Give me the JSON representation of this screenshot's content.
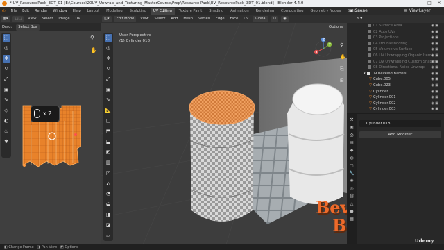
{
  "title": "* UV_ResourcePack_3DT_01 [E:\\Courses\\20UV_Unwrap_and_Texturing_MasterCourse\\Prep\\Resource Pack\\UV_ResourcePack_3DT_01.blend] - Blender 4.4.0",
  "menu": [
    "File",
    "Edit",
    "Render",
    "Window",
    "Help"
  ],
  "workspaces": [
    "Layout",
    "Modeling",
    "Sculpting",
    "UV Editing",
    "Texture Paint",
    "Shading",
    "Animation",
    "Rendering",
    "Compositing",
    "Geometry Nodes",
    "Scripting"
  ],
  "active_workspace": "UV Editing",
  "scene": "Scene",
  "view_layer": "ViewLayer",
  "uv_editor": {
    "header": [
      "View",
      "Select",
      "Image",
      "UV"
    ],
    "drag_label": "Drag:",
    "drag_value": "Select Box",
    "key_hint": "x 2"
  },
  "viewport": {
    "mode": "Edit Mode",
    "menus": [
      "View",
      "Select",
      "Add",
      "Mesh",
      "Vertex",
      "Edge",
      "Face",
      "UV"
    ],
    "orientation": "Global",
    "options": "Options",
    "perspective": "User Perspective",
    "object_info": "(1) Cylinder.018",
    "gizmo_axes": [
      "Y",
      "Z",
      "X"
    ],
    "render_text": [
      "Beve",
      "Ba"
    ]
  },
  "outliner": {
    "items": [
      {
        "label": "01 Surface Area",
        "dim": true,
        "indent": 1
      },
      {
        "label": "02 Auto UVs",
        "dim": true,
        "indent": 1
      },
      {
        "label": "03 Projections",
        "dim": true,
        "indent": 1
      },
      {
        "label": "04 Troubleshooting",
        "dim": true,
        "indent": 1
      },
      {
        "label": "05 Volume vs Surface",
        "dim": true,
        "indent": 1
      },
      {
        "label": "06 UV Unwrapping Organic Items",
        "dim": true,
        "indent": 1
      },
      {
        "label": "07 UV Unwrapping Custom Shapes",
        "dim": true,
        "indent": 1
      },
      {
        "label": "08 Directional Noise Unwrap",
        "dim": true,
        "indent": 1
      },
      {
        "label": "09 Beveled Barrels",
        "dim": false,
        "indent": 1
      },
      {
        "label": "Cube.005",
        "dim": false,
        "indent": 2
      },
      {
        "label": "Cube.023",
        "dim": false,
        "indent": 2
      },
      {
        "label": "Cylinder",
        "dim": false,
        "indent": 2
      },
      {
        "label": "Cylinder.001",
        "dim": false,
        "indent": 2
      },
      {
        "label": "Cylinder.002",
        "dim": false,
        "indent": 2
      },
      {
        "label": "Cylinder.003",
        "dim": false,
        "indent": 2
      }
    ]
  },
  "properties": {
    "object_name": "Cylinder.018",
    "add_modifier": "Add Modifier"
  },
  "statusbar": [
    "Change Frame",
    "Pan View",
    "Options"
  ],
  "watermark": "Udemy",
  "colors": {
    "accent": "#4772b3",
    "uv_orange": "#e8822a",
    "outliner_select": "#334d80",
    "render_text": "#ee6a2a"
  }
}
